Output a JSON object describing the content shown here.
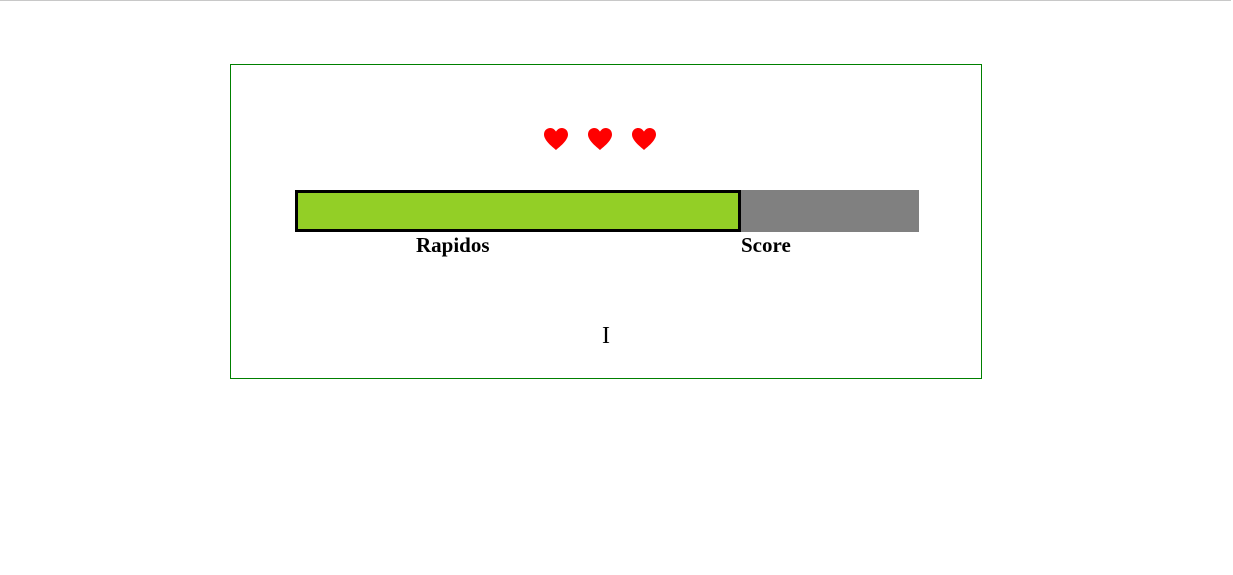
{
  "game": {
    "lives": {
      "count": 3,
      "icon": "heart-icon",
      "color": "#ff0000"
    },
    "progress": {
      "fraction": 0.714,
      "fill_color": "#93cf26",
      "track_color": "#808080",
      "left_label": "Rapidos",
      "right_label": "Score"
    },
    "current_letter": "I",
    "frame_color": "#008000"
  }
}
